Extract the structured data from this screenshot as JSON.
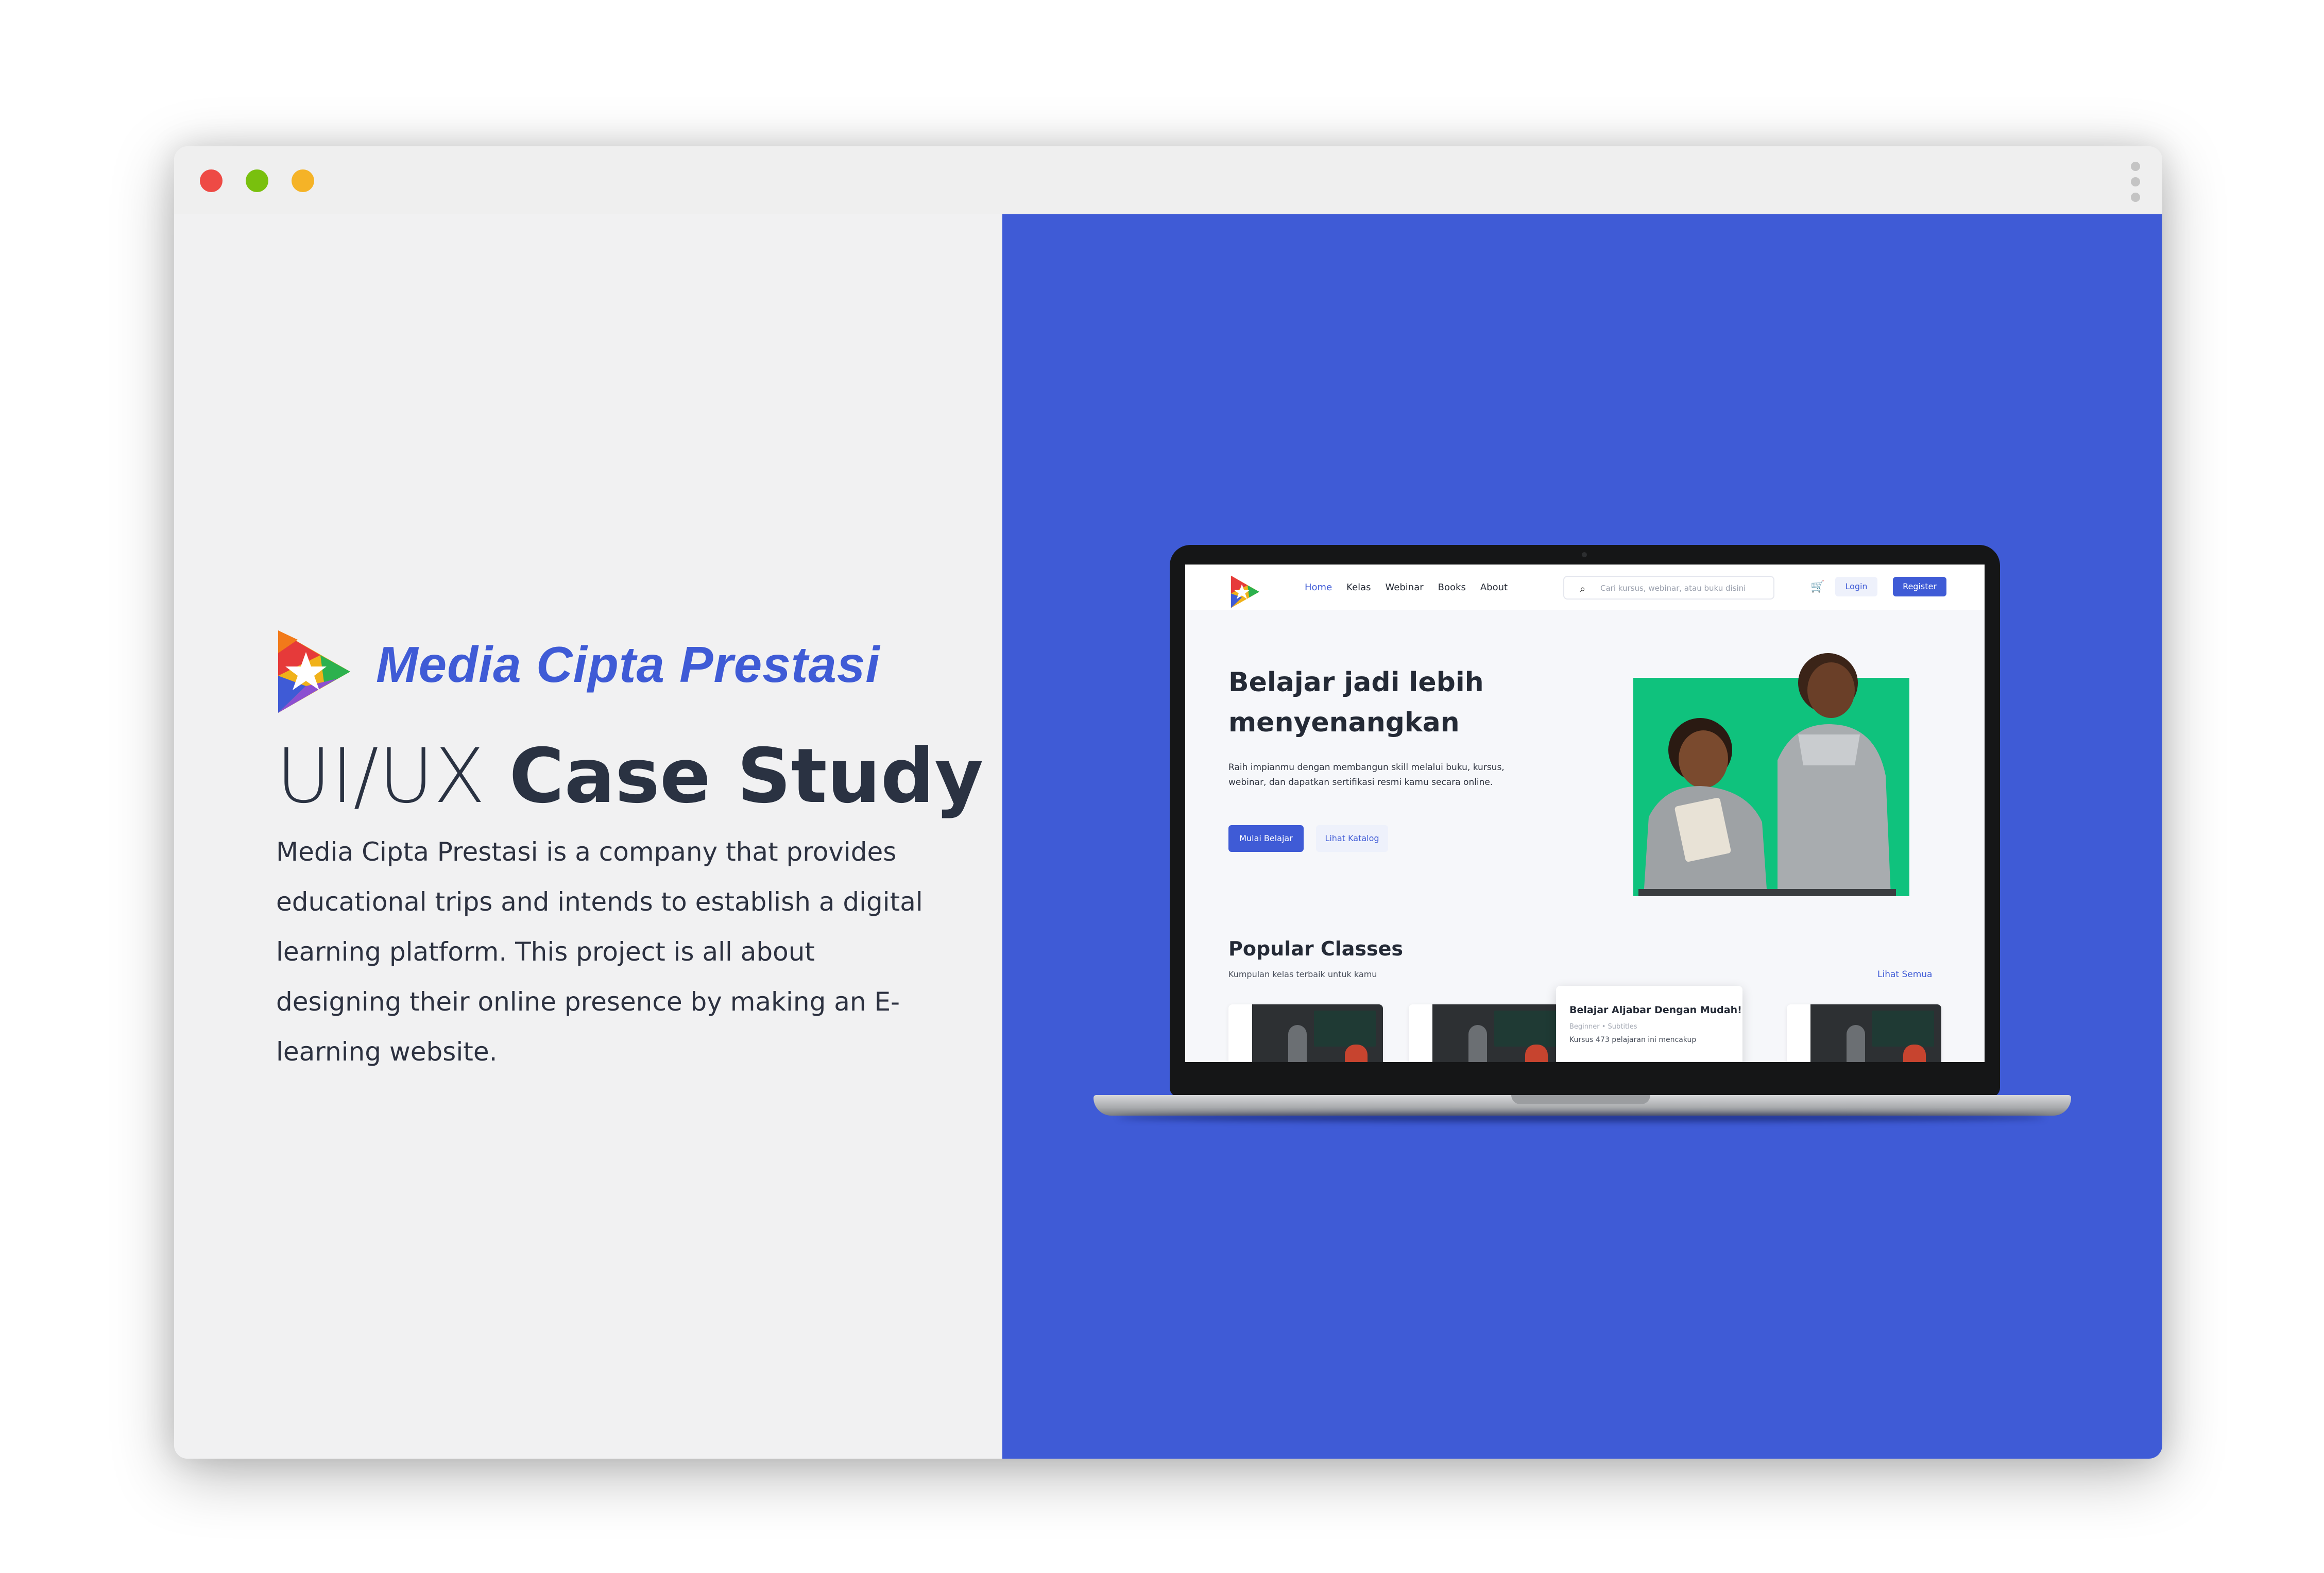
{
  "window": {
    "controls": [
      "close",
      "minimize",
      "maximize"
    ],
    "menu_icon": "kebab-menu-icon"
  },
  "left": {
    "brand_name": "Media Cipta Prestasi",
    "heading_light": "UI/UX ",
    "heading_bold": "Case Study",
    "description": "Media Cipta Prestasi is a company that provides educational trips and intends to establish a digital learning platform. This project is all about designing their online presence by making an E-learning website."
  },
  "screen": {
    "nav": {
      "links": [
        "Home",
        "Kelas",
        "Webinar",
        "Books",
        "About"
      ],
      "search_placeholder": "Cari kursus, webinar, atau buku disini",
      "login": "Login",
      "register": "Register"
    },
    "hero": {
      "title": "Belajar jadi lebih menyenangkan",
      "text": "Raih impianmu dengan membangun skill melalui buku, kursus, webinar, dan dapatkan sertifikasi resmi kamu secara online.",
      "primary_button": "Mulai Belajar",
      "secondary_button": "Lihat Katalog"
    },
    "popular": {
      "title": "Popular Classes",
      "subtitle": "Kumpulan kelas terbaik untuk kamu",
      "see_all": "Lihat Semua",
      "popup_title": "Belajar Aljabar Dengan Mudah!",
      "popup_meta": "Beginner • Subtitles",
      "popup_desc": "Kursus 473 pelajaran ini mencakup"
    }
  },
  "colors": {
    "brand_blue": "#3f5bd6",
    "hero_green": "#0fc27d",
    "heading_dark": "#2a3242"
  }
}
